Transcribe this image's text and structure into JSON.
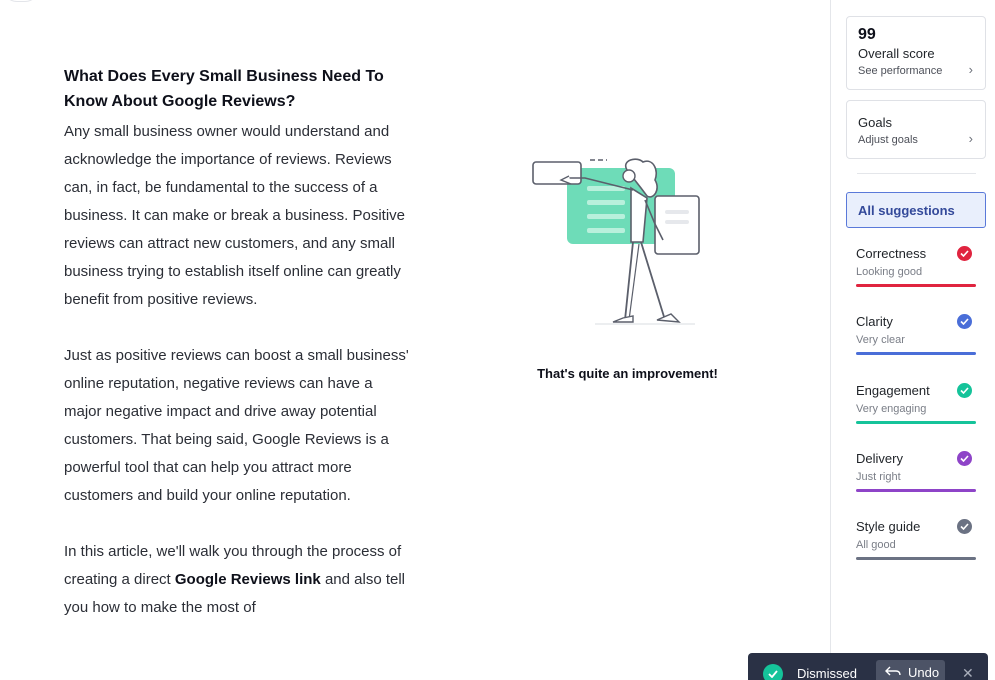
{
  "document": {
    "heading": "What Does Every Small Business Need To Know About Google Reviews?",
    "paragraph1": "Any small business owner would understand and acknowledge the importance of reviews. Reviews can, in fact, be fundamental to the success of a business. It can make or break a business. Positive reviews can attract new customers, and any small business trying to establish itself online can greatly benefit from positive reviews.",
    "paragraph2": "Just as positive reviews can boost a small business' online reputation, negative reviews can have a major negative impact and drive away potential customers. That being said, Google Reviews is a powerful tool that can help you attract more customers and build your online reputation.",
    "paragraph3_start": "In this article, we'll walk you through the process of creating a direct ",
    "paragraph3_bold": "Google Reviews link",
    "paragraph3_end": " and also tell you how to make the most of"
  },
  "illustration": {
    "caption": "That's quite an improvement!",
    "colors": {
      "accent": "#5ed8b0",
      "line": "#5b5f6b"
    }
  },
  "sidebar": {
    "score": {
      "value": "99",
      "title": "Overall score",
      "link": "See performance"
    },
    "goals": {
      "title": "Goals",
      "link": "Adjust goals"
    },
    "all_suggestions": "All suggestions",
    "categories": [
      {
        "title": "Correctness",
        "status": "Looking good",
        "color": "#e0243f"
      },
      {
        "title": "Clarity",
        "status": "Very clear",
        "color": "#4a6ed8"
      },
      {
        "title": "Engagement",
        "status": "Very engaging",
        "color": "#15c39a"
      },
      {
        "title": "Delivery",
        "status": "Just right",
        "color": "#8e44c8"
      },
      {
        "title": "Style guide",
        "status": "All good",
        "color": "#6b7283"
      }
    ]
  },
  "toast": {
    "message": "Dismissed",
    "undo_label": "Undo",
    "close_icon": "close-icon"
  }
}
